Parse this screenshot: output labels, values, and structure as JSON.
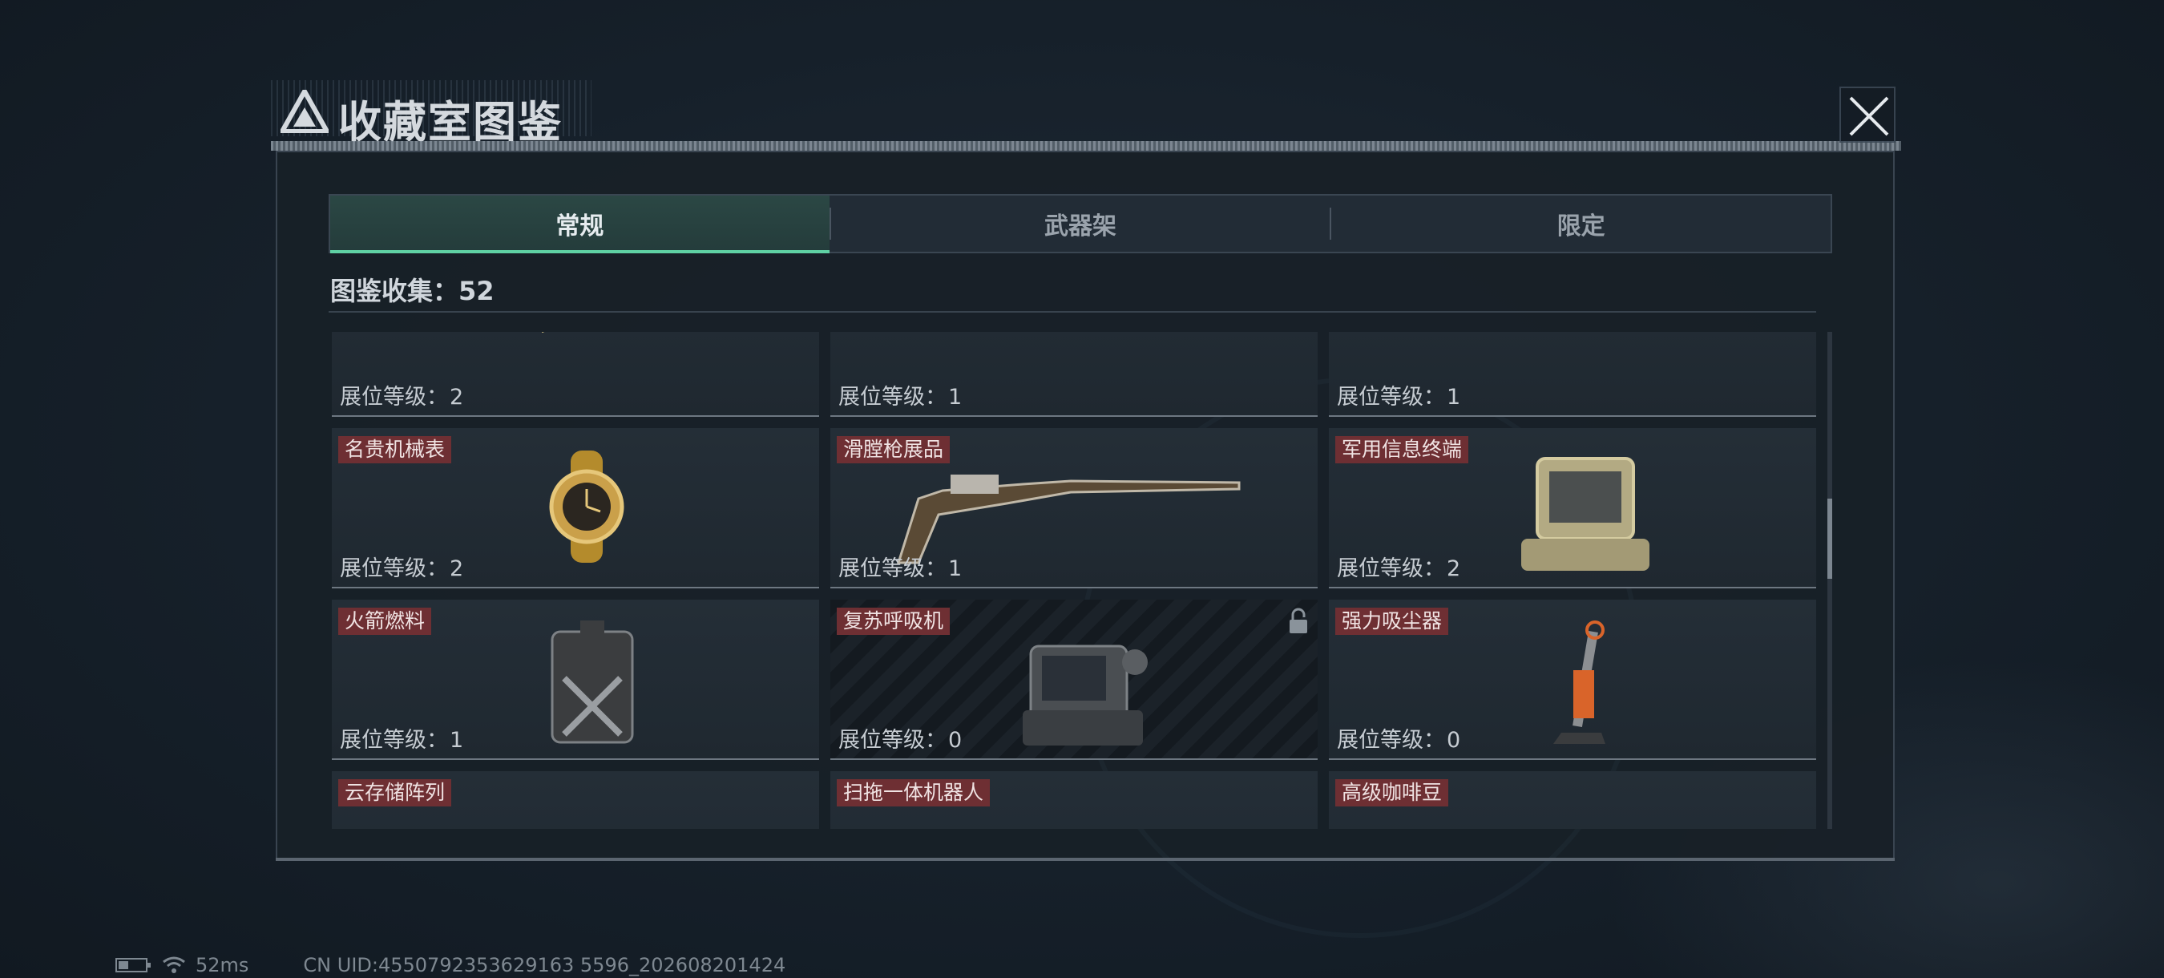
{
  "header": {
    "title": "收藏室图鉴"
  },
  "tabs": [
    {
      "label": "常规",
      "active": true
    },
    {
      "label": "武器架",
      "active": false
    },
    {
      "label": "限定",
      "active": false
    }
  ],
  "collection": {
    "label": "图鉴收集：52"
  },
  "level_prefix": "展位等级：",
  "items": [
    {
      "name": "",
      "level": "2",
      "locked": false,
      "icon": "gold-circuit-board"
    },
    {
      "name": "",
      "level": "1",
      "locked": false,
      "icon": "red-black-case"
    },
    {
      "name": "",
      "level": "1",
      "locked": false,
      "icon": "armored-vehicle"
    },
    {
      "name": "名贵机械表",
      "level": "2",
      "locked": false,
      "icon": "gold-watch"
    },
    {
      "name": "滑膛枪展品",
      "level": "1",
      "locked": false,
      "icon": "flintlock-musket"
    },
    {
      "name": "军用信息终端",
      "level": "2",
      "locked": false,
      "icon": "rugged-laptop"
    },
    {
      "name": "火箭燃料",
      "level": "1",
      "locked": false,
      "icon": "fuel-canister"
    },
    {
      "name": "复苏呼吸机",
      "level": "0",
      "locked": true,
      "icon": "ventilator"
    },
    {
      "name": "强力吸尘器",
      "level": "0",
      "locked": false,
      "icon": "vacuum-cleaner"
    },
    {
      "name": "云存储阵列",
      "level": "",
      "locked": false,
      "icon": "storage-array"
    },
    {
      "name": "扫拖一体机器人",
      "level": "",
      "locked": false,
      "icon": "robot-mop"
    },
    {
      "name": "高级咖啡豆",
      "level": "",
      "locked": false,
      "icon": "coffee-bag"
    }
  ],
  "footer": {
    "ping": "52ms",
    "uid": "CN UID:4550792353629163 5596_202608201424"
  },
  "colors": {
    "accent": "#5fd1a4",
    "name_tag": "#6e2f33"
  }
}
